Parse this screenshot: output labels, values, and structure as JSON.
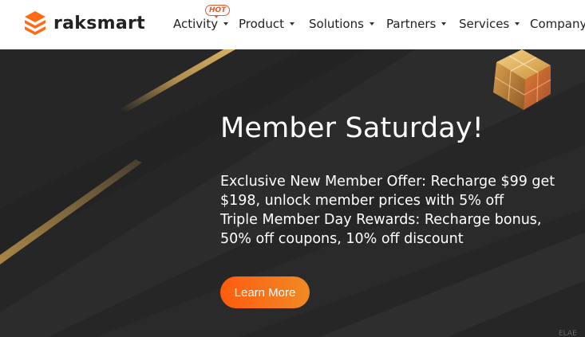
{
  "brand": {
    "name": "raksmart"
  },
  "nav": {
    "items": [
      {
        "label": "Activity"
      },
      {
        "label": "Product"
      },
      {
        "label": "Solutions"
      },
      {
        "label": "Partners"
      },
      {
        "label": "Services"
      },
      {
        "label": "Company"
      }
    ],
    "hot_badge": "HOT"
  },
  "hero": {
    "title": "Member Saturday!",
    "lines": [
      "Exclusive New Member Offer: Recharge $99 get",
      "$198, unlock member prices with 5% off",
      "Triple Member Day Rewards: Recharge bonus,",
      "50% off coupons, 10% off discount"
    ],
    "cta_label": "Learn More",
    "corner_text": "ELAE"
  },
  "colors": {
    "accent": "#ff5b0f",
    "hero_bg": "#262626",
    "gold": "#c8a055"
  }
}
